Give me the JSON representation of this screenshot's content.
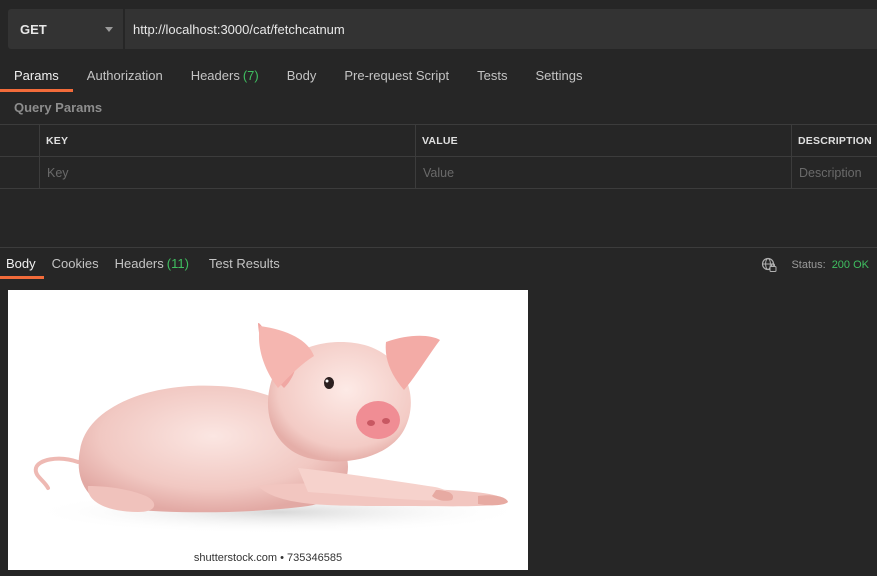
{
  "request": {
    "method": "GET",
    "url": "http://localhost:3000/cat/fetchcatnum"
  },
  "request_tabs": [
    {
      "label": "Params",
      "count": "",
      "active": true
    },
    {
      "label": "Authorization",
      "count": ""
    },
    {
      "label": "Headers",
      "count": "(7)"
    },
    {
      "label": "Body",
      "count": ""
    },
    {
      "label": "Pre-request Script",
      "count": ""
    },
    {
      "label": "Tests",
      "count": ""
    },
    {
      "label": "Settings",
      "count": ""
    }
  ],
  "query_params": {
    "title": "Query Params",
    "columns": [
      "KEY",
      "VALUE",
      "DESCRIPTION"
    ],
    "placeholders": {
      "key": "Key",
      "value": "Value",
      "description": "Description"
    }
  },
  "response_tabs": [
    {
      "label": "Body",
      "count": "",
      "active": true
    },
    {
      "label": "Cookies",
      "count": ""
    },
    {
      "label": "Headers",
      "count": "(11)"
    },
    {
      "label": "Test Results",
      "count": ""
    }
  ],
  "status": {
    "label": "Status:",
    "value": "200 OK"
  },
  "response_image": {
    "subject": "piglet lying down on white background",
    "watermark": "shutterstock.com • 735346585"
  },
  "colors": {
    "accent": "#f26b3a",
    "success": "#3fbf60",
    "background": "#262626"
  },
  "icons": {
    "method_caret": "chevron-down-icon",
    "network": "globe-icon"
  }
}
